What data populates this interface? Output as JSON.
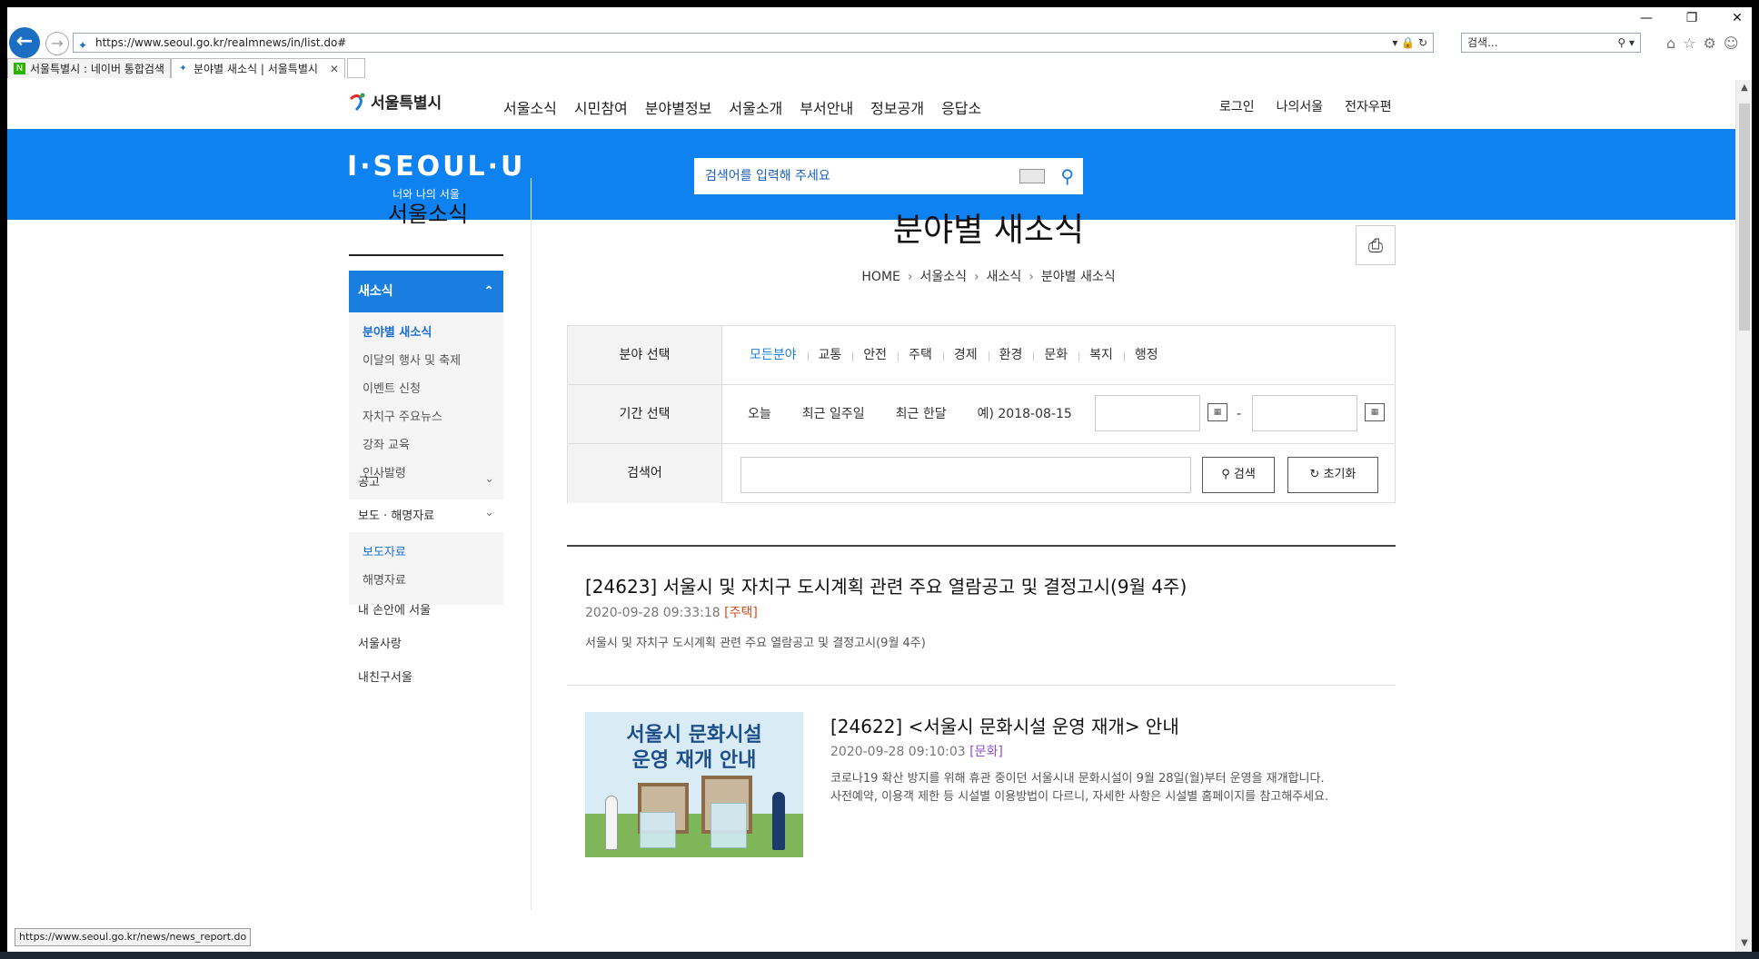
{
  "browser": {
    "url": "https://www.seoul.go.kr/realmnews/in/list.do#",
    "search_placeholder": "검색...",
    "tabs": [
      {
        "label": "서울특별시 : 네이버 통합검색"
      },
      {
        "label": "분야별 새소식 | 서울특별시"
      }
    ],
    "status_url": "https://www.seoul.go.kr/news/news_report.do"
  },
  "gnb": {
    "logo": "서울특별시",
    "menu": [
      "서울소식",
      "시민참여",
      "분야별정보",
      "서울소개",
      "부서안내",
      "정보공개",
      "응답소"
    ],
    "util": [
      "로그인",
      "나의서울",
      "전자우편"
    ]
  },
  "hero": {
    "brand": "I·SEOUL·U",
    "brand_sub": "너와 나의 서울",
    "search_placeholder": "검색어를 입력해 주세요"
  },
  "lnb": {
    "title": "서울소식",
    "active_group": "새소식",
    "sub_items": [
      "분야별 새소식",
      "이달의 행사 및 축제",
      "이벤트 신청",
      "자치구 주요뉴스",
      "강좌 교육",
      "인사발령"
    ],
    "groups": [
      "공고",
      "보도 · 해명자료"
    ],
    "press_sub": [
      "보도자료",
      "해명자료"
    ],
    "others": [
      "내 손안에 서울",
      "서울사랑",
      "내친구서울"
    ]
  },
  "content": {
    "title": "분야별 새소식",
    "breadcrumb": [
      "HOME",
      "서울소식",
      "새소식",
      "분야별 새소식"
    ],
    "filter": {
      "category_label": "분야 선택",
      "categories": [
        "모든분야",
        "교통",
        "안전",
        "주택",
        "경제",
        "환경",
        "문화",
        "복지",
        "행정"
      ],
      "period_label": "기간 선택",
      "periods": [
        "오늘",
        "최근 일주일",
        "최근 한달"
      ],
      "date_example": "예) 2018-08-15",
      "date_dash": "-",
      "keyword_label": "검색어",
      "search_btn": "검색",
      "reset_btn": "초기화"
    },
    "items": [
      {
        "title": "[24623] 서울시 및 자치구 도시계획 관련 주요 열람공고 및 결정고시(9월 4주)",
        "date": "2020-09-28 09:33:18",
        "category": "[주택]",
        "desc": "서울시 및 자치구 도시계획 관련 주요 열람공고 및 결정고시(9월 4주)"
      },
      {
        "title": "[24622] <서울시 문화시설 운영 재개> 안내",
        "date": "2020-09-28 09:10:03",
        "category": "[문화]",
        "desc_line1": "코로나19 확산 방지를 위해 휴관 중이던 서울시내 문화시설이 9월 28일(월)부터 운영을 재개합니다.",
        "desc_line2": "사전예약, 이용객 제한 등 시설별 이용방법이 다르니, 자세한 사항은 시설별 홈페이지를 참고해주세요.",
        "thumb_line1": "서울시 문화시설",
        "thumb_line2": "운영 재개 안내"
      }
    ]
  }
}
